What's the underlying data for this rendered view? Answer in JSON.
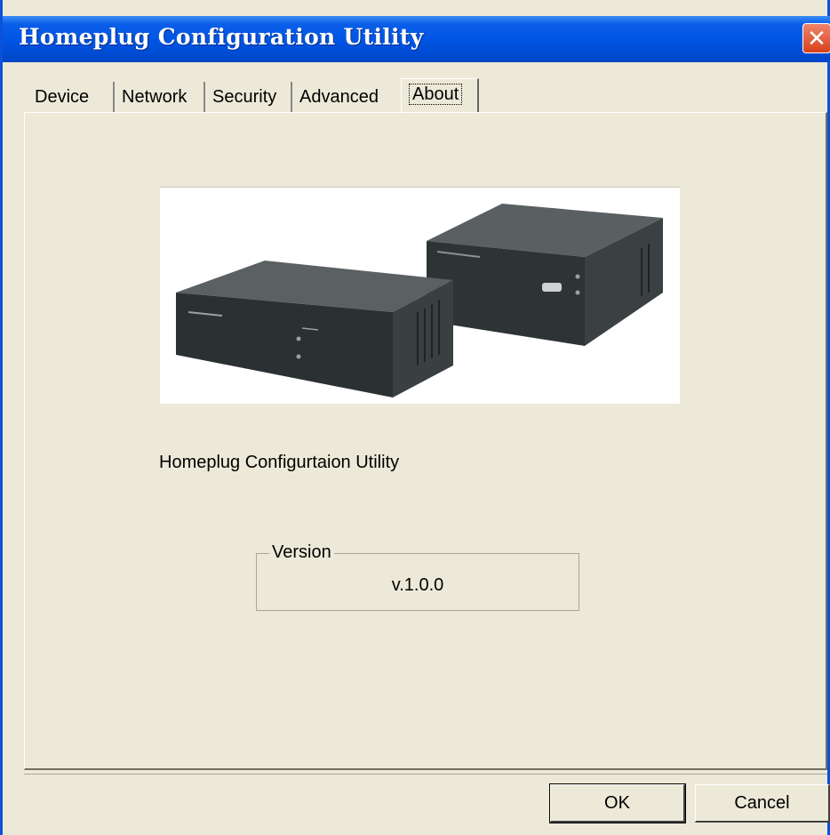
{
  "window": {
    "title": "Homeplug Configuration Utility",
    "close_glyph": "✕"
  },
  "tabs": [
    {
      "label": "Device"
    },
    {
      "label": "Network"
    },
    {
      "label": "Security"
    },
    {
      "label": "Advanced"
    },
    {
      "label": "About",
      "active": true
    }
  ],
  "about": {
    "product_image": "homeplug-adapters-photo",
    "product_name": "Homeplug Configurtaion Utility",
    "version_legend": "Version",
    "version_value": "v.1.0.0"
  },
  "buttons": {
    "ok": "OK",
    "cancel": "Cancel"
  },
  "colors": {
    "titlebar": "#0054e3",
    "dialog_bg": "#ece9d8",
    "close_button": "#d8401c"
  }
}
